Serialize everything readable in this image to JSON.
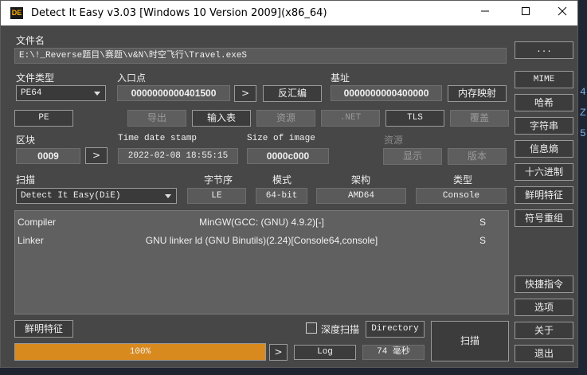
{
  "window": {
    "title": "Detect It Easy v3.03 [Windows 10 Version 2009](x86_64)",
    "icon_text": "DE",
    "minimize_icon": "minimize-icon",
    "maximize_icon": "maximize-icon",
    "close_icon": "close-icon"
  },
  "file": {
    "label": "文件名",
    "path": "E:\\!_Reverse题目\\赛题\\v&N\\时空飞行\\Travel.exeS",
    "browse_label": "..."
  },
  "file_type": {
    "label": "文件类型",
    "value": "PE64"
  },
  "entry_point": {
    "label": "入口点",
    "value": "0000000000401500",
    "arrow_label": ">",
    "disasm_label": "反汇编"
  },
  "base_address": {
    "label": "基址",
    "value": "0000000000400000",
    "memory_map_label": "内存映射"
  },
  "pe_buttons": {
    "pe": "PE",
    "export": "导出",
    "import": "输入表",
    "resources": "资源",
    "net": ".NET",
    "tls": "TLS",
    "overlay": "覆盖"
  },
  "sections": {
    "label": "区块",
    "value": "0009",
    "arrow_label": ">"
  },
  "timestamp": {
    "label": "Time date stamp",
    "value": "2022-02-08 18:55:15"
  },
  "image_size": {
    "label": "Size of image",
    "value": "0000c000"
  },
  "resources_panel": {
    "label": "资源",
    "show_label": "显示",
    "version_label": "版本"
  },
  "scan": {
    "label": "扫描",
    "engine": "Detect It Easy(DiE)",
    "endianness_label": "字节序",
    "endianness": "LE",
    "mode_label": "模式",
    "mode": "64-bit",
    "arch_label": "架构",
    "arch": "AMD64",
    "type_label": "类型",
    "type": "Console"
  },
  "results": [
    {
      "kind": "Compiler",
      "name": "MinGW(GCC: (GNU) 4.9.2)[-]",
      "flag": "S"
    },
    {
      "kind": "Linker",
      "name": "GNU linker ld (GNU Binutils)(2.24)[Console64,console]",
      "flag": "S"
    }
  ],
  "bottom": {
    "signatures_label": "鲜明特征",
    "deep_scan_label": "深度扫描",
    "deep_scan_checked": false,
    "directory_label": "Directory",
    "progress_text": "100%",
    "progress_value": 1.0,
    "arrow_label": ">",
    "log_label": "Log",
    "elapsed": "74 毫秒",
    "scan_button": "扫描"
  },
  "right_panel": {
    "mime": "MIME",
    "hash": "哈希",
    "strings": "字符串",
    "entropy": "信息熵",
    "hex": "十六进制",
    "signatures": "鲜明特征",
    "demangle": "符号重组",
    "shortcuts": "快捷指令",
    "options": "选项",
    "about": "关于",
    "exit": "退出"
  },
  "background": {
    "chars": [
      "4",
      "Z",
      "5"
    ]
  },
  "colors": {
    "window_bg": "#474747",
    "progress_fill": "#d98a1e",
    "results_bg": "#606060"
  }
}
